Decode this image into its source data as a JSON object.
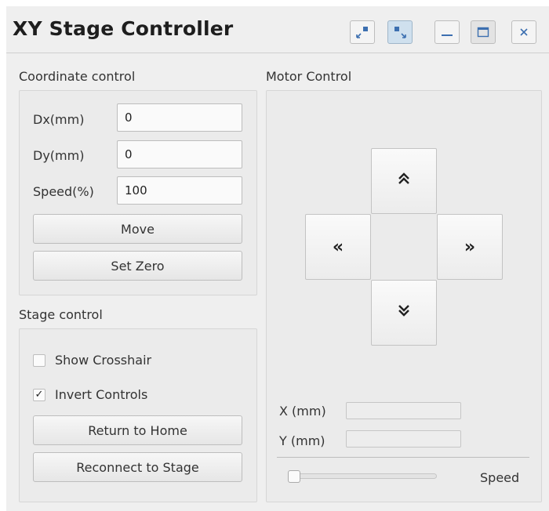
{
  "window": {
    "title": "XY Stage Controller",
    "title_buttons": [
      {
        "icon": "collapse-arrows-icon"
      },
      {
        "icon": "expand-arrows-icon",
        "active": true
      },
      {
        "icon": "minimize-icon"
      },
      {
        "icon": "maximize-icon"
      },
      {
        "icon": "close-icon"
      }
    ]
  },
  "coordinate_control": {
    "heading": "Coordinate control",
    "dx_label": "Dx(mm)",
    "dx_value": "0",
    "dy_label": "Dy(mm)",
    "dy_value": "0",
    "speed_label": "Speed(%)",
    "speed_value": "100",
    "move_button": "Move",
    "set_zero_button": "Set Zero"
  },
  "stage_control": {
    "heading": "Stage control",
    "show_crosshair_label": "Show Crosshair",
    "show_crosshair_checked": false,
    "invert_controls_label": "Invert Controls",
    "invert_controls_checked": true,
    "return_home_button": "Return to Home",
    "reconnect_button": "Reconnect to Stage"
  },
  "motor_control": {
    "heading": "Motor Control",
    "up_symbol": "≽",
    "down_symbol": "≽",
    "left_symbol": "«",
    "right_symbol": "»",
    "x_label": "X (mm)",
    "x_value": "",
    "y_label": "Y (mm)",
    "y_value": "",
    "speed_label": "Speed",
    "speed_level": 0
  },
  "colors": {
    "background": "#efefef",
    "active_button": "#cfe0ee"
  }
}
